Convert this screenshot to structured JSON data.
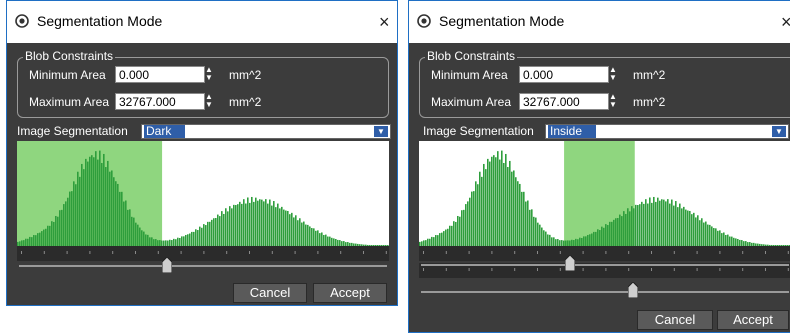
{
  "colors": {
    "accent": "#1f6fc4",
    "histogram_bar": "#2e9e3c",
    "selected_range": "#8fd67f",
    "dialog_bg": "#3c3c3c"
  },
  "dialogs": [
    {
      "title": "Segmentation Mode",
      "close_glyph": "×",
      "blob_group_label": "Blob Constraints",
      "min_area_label": "Minimum Area",
      "min_area_value": "0.000",
      "max_area_label": "Maximum Area",
      "max_area_value": "32767.000",
      "unit": "mm^2",
      "segmentation_label": "Image Segmentation",
      "segmentation_value": "Dark",
      "cancel_label": "Cancel",
      "accept_label": "Accept",
      "range_start": 0.0,
      "range_end": 0.39,
      "sliders": [
        0.39
      ]
    },
    {
      "title": "Segmentation Mode",
      "close_glyph": "×",
      "blob_group_label": "Blob Constraints",
      "min_area_label": "Minimum Area",
      "min_area_value": "0.000",
      "max_area_label": "Maximum Area",
      "max_area_value": "32767.000",
      "unit": "mm^2",
      "segmentation_label": "Image Segmentation",
      "segmentation_value": "Inside",
      "cancel_label": "Cancel",
      "accept_label": "Accept",
      "range_start": 0.39,
      "range_end": 0.58,
      "sliders": [
        0.39,
        0.58
      ]
    }
  ]
}
